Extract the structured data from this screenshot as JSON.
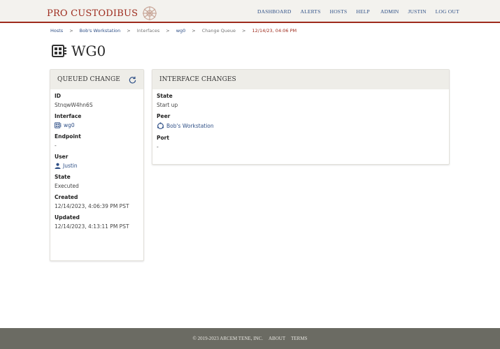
{
  "brand": {
    "name": "PRO CUSTODIBUS"
  },
  "nav": {
    "left": [
      "DASHBOARD",
      "ALERTS",
      "HOSTS",
      "HELP"
    ],
    "right": [
      "ADMIN",
      "JUSTIN",
      "LOG OUT"
    ]
  },
  "breadcrumb": {
    "items": [
      "Hosts",
      "Bob's Workstation",
      "Interfaces",
      "wg0",
      "Change Queue",
      "12/14/23, 04:06 PM"
    ],
    "separator": ">"
  },
  "page": {
    "title": "WG0"
  },
  "queued_change": {
    "header": "QUEUED CHANGE",
    "fields": {
      "id_label": "ID",
      "id_value": "StnqwW4hn6S",
      "interface_label": "Interface",
      "interface_value": "wg0",
      "endpoint_label": "Endpoint",
      "endpoint_value": "-",
      "user_label": "User",
      "user_value": "Justin",
      "state_label": "State",
      "state_value": "Executed",
      "created_label": "Created",
      "created_value": "12/14/2023, 4:06:39 PM PST",
      "updated_label": "Updated",
      "updated_value": "12/14/2023, 4:13:11 PM PST"
    }
  },
  "interface_changes": {
    "header": "INTERFACE CHANGES",
    "fields": {
      "state_label": "State",
      "state_value": "Start up",
      "peer_label": "Peer",
      "peer_value": "Bob's Workstation",
      "port_label": "Port",
      "port_value": "-"
    }
  },
  "footer": {
    "copyright": "© 2019-2023 ARCEM TENE, INC.",
    "about": "ABOUT",
    "terms": "TERMS"
  },
  "colors": {
    "brand_red": "#9e2b1d",
    "link_blue": "#2e4f86",
    "footer_bg": "#6b6b63",
    "header_bg": "#f3f2ee"
  },
  "icons": [
    "brand-emblem-icon",
    "interface-icon",
    "refresh-icon",
    "user-icon",
    "peer-icon"
  ]
}
